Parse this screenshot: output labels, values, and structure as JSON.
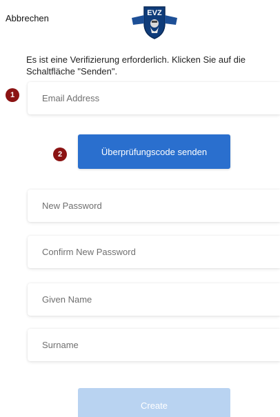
{
  "header": {
    "cancel_label": "Abbrechen",
    "logo_text": "EVZ"
  },
  "intro_text": "Es ist eine Verifizierung erforderlich. Klicken Sie auf die Schaltfläche \"Senden\".",
  "markers": [
    "1",
    "2"
  ],
  "form": {
    "email_placeholder": "Email Address",
    "send_code_label": "Überprüfungscode senden",
    "new_password_placeholder": "New Password",
    "confirm_password_placeholder": "Confirm New Password",
    "given_name_placeholder": "Given Name",
    "surname_placeholder": "Surname",
    "create_label": "Create"
  },
  "colors": {
    "primary_button": "#2a6fce",
    "disabled_button": "#b9d3f1",
    "marker": "#8b1313"
  }
}
